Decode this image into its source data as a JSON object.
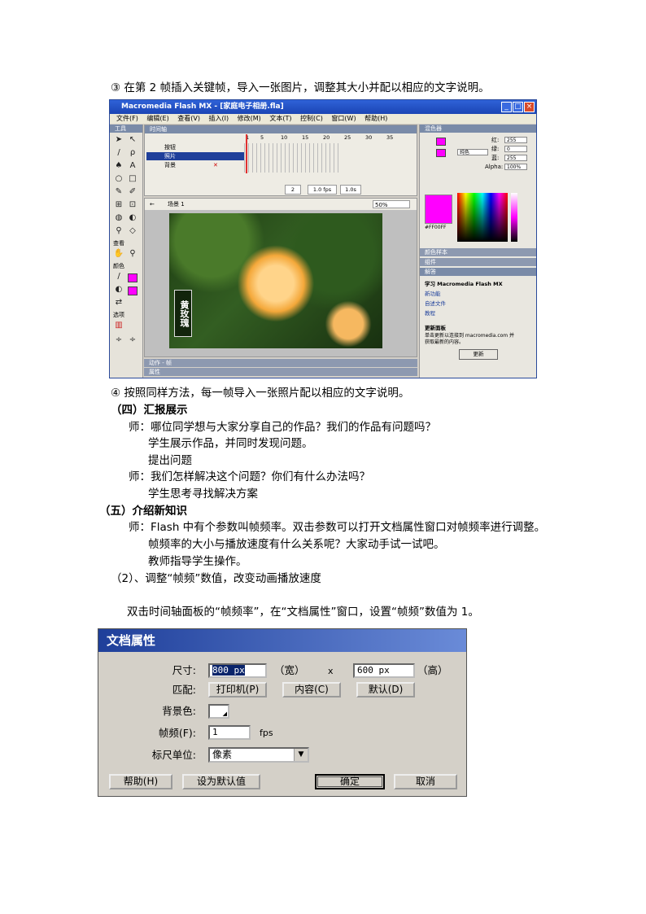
{
  "step3": "③ 在第 2 帧插入关键帧，导入一张图片，调整其大小并配以相应的文字说明。",
  "flash_window": {
    "title": "Macromedia Flash MX - [家庭电子相册.fla]",
    "menus": [
      "文件(F)",
      "编辑(E)",
      "查看(V)",
      "插入(I)",
      "修改(M)",
      "文本(T)",
      "控制(C)",
      "窗口(W)",
      "帮助(H)"
    ],
    "tools_header": "工具",
    "tools_view_label": "查看",
    "tools_colors_label": "颜色",
    "tools_options_label": "选项",
    "timeline_header": "时间轴",
    "frame_numbers": [
      "1",
      "5",
      "10",
      "15",
      "20",
      "25",
      "30",
      "35"
    ],
    "layers": [
      "按钮",
      "照片",
      "背景"
    ],
    "timeline_status": {
      "frame": "2",
      "fps": "1.0 fps",
      "time": "1.0s"
    },
    "scene_label": "场景 1",
    "zoom": "50%",
    "photo_caption": "黄玫瑰",
    "mixer_header": "混色器",
    "rgb": [
      {
        "label": "红:",
        "value": "255"
      },
      {
        "label": "绿:",
        "value": "0"
      },
      {
        "label": "蓝:",
        "value": "255"
      }
    ],
    "alpha": {
      "label": "Alpha:",
      "value": "100%"
    },
    "fill_type": "纯色",
    "hex_value": "#FF00FF",
    "panel_swatches": "颜色样本",
    "panel_components": "组件",
    "panel_answers": "解答",
    "learn_title": "学习 Macromedia Flash MX",
    "learn_links": [
      "新功能",
      "自述文件",
      "教程"
    ],
    "update_title": "更新面板",
    "update_text1": "单击更新以连接到 macromedia.com 并",
    "update_text2": "获取最新的内容。",
    "update_button": "更新",
    "actions_bar": "动作 - 帧",
    "properties_bar": "属性",
    "colors": {
      "titlebar": "#1b45b4",
      "accent": "#ff00ff"
    }
  },
  "step4": "④ 按照同样方法，每一帧导入一张照片配以相应的文字说明。",
  "section4": "（四）汇报展示",
  "dialogue1": [
    "师：哪位同学想与大家分享自己的作品？我们的作品有问题吗？",
    "学生展示作品，并同时发现问题。",
    "提出问题",
    "师：我们怎样解决这个问题？你们有什么办法吗？",
    "学生思考寻找解决方案"
  ],
  "section5": "（五）介绍新知识",
  "dialogue2": [
    "师：Flash 中有个参数叫帧频率。双击参数可以打开文档属性窗口对帧频率进行调整。",
    "帧频率的大小与播放速度有什么关系呢？大家动手试一试吧。",
    "教师指导学生操作。"
  ],
  "subsection2": "（2）、调整“帧频”数值，改变动画播放速度",
  "instruction": "双击时间轴面板的“帧频率”，在“文档属性”窗口，设置“帧频”数值为 1。",
  "dialog": {
    "title": "文档属性",
    "size_label": "尺寸:",
    "width_value": "800 px",
    "width_unit": "（宽）",
    "times": "x",
    "height_value": "600 px",
    "height_unit": "（高）",
    "match_label": "匹配:",
    "match_printer": "打印机(P)",
    "match_contents": "内容(C)",
    "match_default": "默认(D)",
    "bg_label": "背景色:",
    "fps_label": "帧频(F):",
    "fps_value": "1",
    "fps_unit": "fps",
    "ruler_label": "标尺单位:",
    "ruler_value": "像素",
    "help_button": "帮助(H)",
    "make_default_button": "设为默认值",
    "ok_button": "确定",
    "cancel_button": "取消"
  }
}
